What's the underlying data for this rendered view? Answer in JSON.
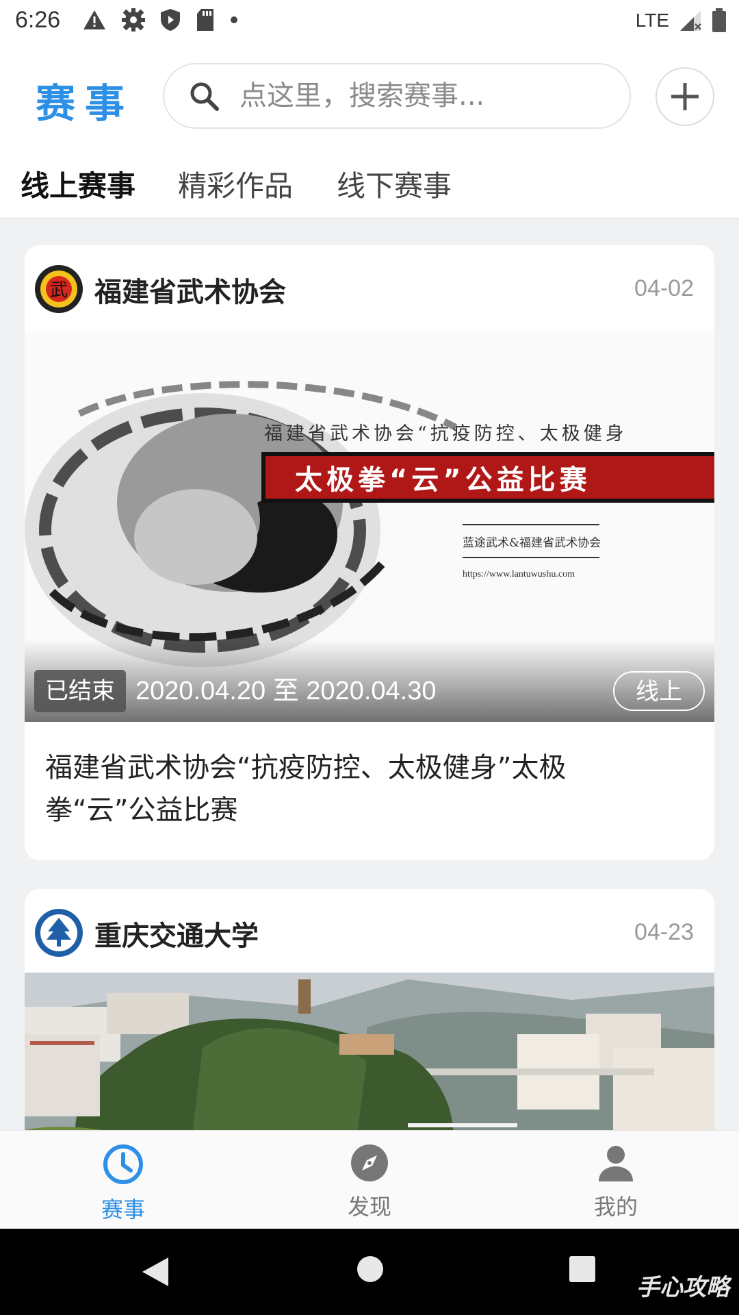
{
  "status_bar": {
    "time": "6:26",
    "network": "LTE",
    "icons_left": [
      "warning-icon",
      "gear-icon",
      "shield-icon",
      "sd-card-icon",
      "dot-icon"
    ],
    "icons_right": [
      "signal-icon",
      "battery-icon"
    ]
  },
  "header": {
    "title": "赛事",
    "search_placeholder": "点这里，搜索赛事...",
    "add_icon": "plus-icon",
    "accent_color": "#2d8fe5"
  },
  "tabs": [
    {
      "label": "线上赛事",
      "active": true
    },
    {
      "label": "精彩作品",
      "active": false
    },
    {
      "label": "线下赛事",
      "active": false
    }
  ],
  "cards": [
    {
      "org": "福建省武术协会",
      "date": "04-02",
      "cover": {
        "headline": "福建省武术协会“抗疫防控、太极健身",
        "banner": "太极拳“云”公益比赛",
        "sub1": "蓝途武术&福建省武术协会",
        "sub2": "https://www.lantuwushu.com",
        "logo_char": "武"
      },
      "status": "已结束",
      "date_range": "2020.04.20 至 2020.04.30",
      "mode": "线上",
      "title": "福建省武术协会“抗疫防控、太极健身”太极拳“云”公益比赛"
    },
    {
      "org": "重庆交通大学",
      "date": "04-23"
    }
  ],
  "bottom_nav": [
    {
      "label": "赛事",
      "icon": "clock-icon",
      "active": true
    },
    {
      "label": "发现",
      "icon": "compass-icon",
      "active": false
    },
    {
      "label": "我的",
      "icon": "person-icon",
      "active": false
    }
  ],
  "watermark": "手心攻略"
}
